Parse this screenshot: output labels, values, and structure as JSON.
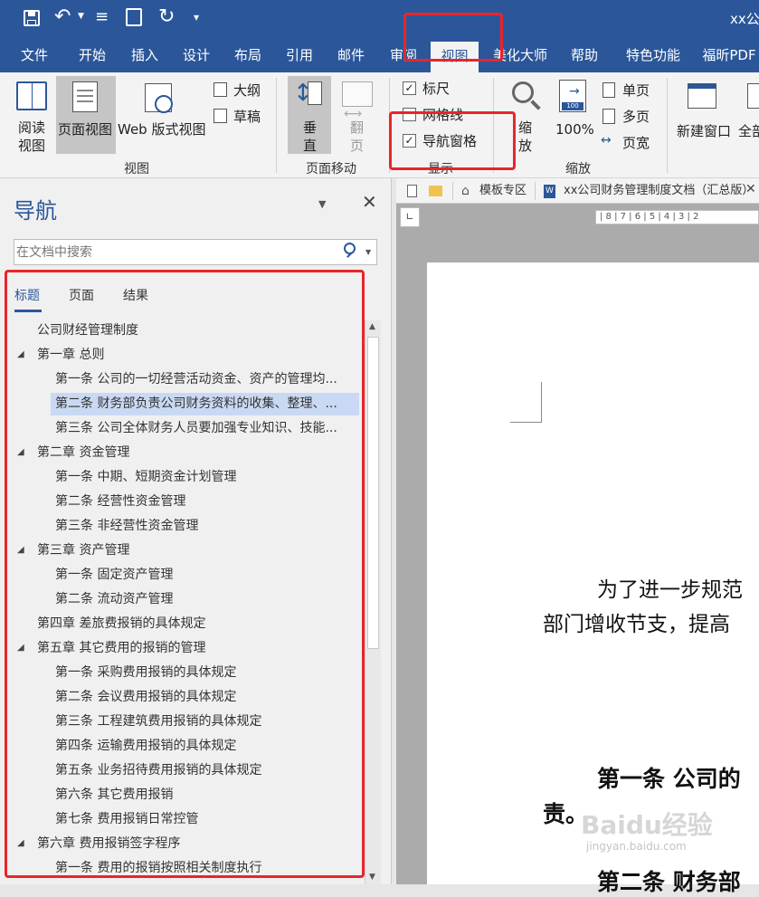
{
  "titlebar": {
    "title": "xx公"
  },
  "tabs": [
    "文件",
    "开始",
    "插入",
    "设计",
    "布局",
    "引用",
    "邮件",
    "审阅",
    "视图",
    "美化大师",
    "帮助",
    "特色功能",
    "福昕PDF"
  ],
  "ribbon": {
    "view_group": {
      "read_label": "阅读\n视图",
      "read_l1": "阅读",
      "read_l2": "视图",
      "print_label": "页面视图",
      "web_label": "Web 版式视图",
      "outline_label": "大纲",
      "draft_label": "草稿",
      "group_label": "视图"
    },
    "page_move": {
      "vertical_l1": "垂",
      "vertical_l2": "直",
      "flip_l1": "翻",
      "flip_l2": "页",
      "group_label": "页面移动"
    },
    "show": {
      "ruler": "标尺",
      "gridlines": "网格线",
      "nav_pane": "导航窗格",
      "group_label": "显示",
      "ruler_checked": true,
      "gridlines_checked": false,
      "nav_checked": true
    },
    "zoom": {
      "zoom_l1": "缩",
      "zoom_l2": "放",
      "percent": "100%",
      "one_page": "单页",
      "multi_page": "多页",
      "page_width": "页宽",
      "group_label": "缩放"
    },
    "window": {
      "new_window": "新建窗口",
      "arrange_all": "全部"
    }
  },
  "nav": {
    "title": "导航",
    "search_placeholder": "在文档中搜索",
    "subtabs": [
      "标题",
      "页面",
      "结果"
    ],
    "items": [
      {
        "text": "公司财经管理制度",
        "level": 0
      },
      {
        "text": "第一章 总则",
        "level": 1
      },
      {
        "text": "第一条 公司的一切经营活动资金、资产的管理均...",
        "level": 2
      },
      {
        "text": "第二条 财务部负责公司财务资料的收集、整理、...",
        "level": 2,
        "selected": true
      },
      {
        "text": "第三条 公司全体财务人员要加强专业知识、技能...",
        "level": 2
      },
      {
        "text": "第二章 资金管理",
        "level": 1
      },
      {
        "text": "第一条 中期、短期资金计划管理",
        "level": 2
      },
      {
        "text": "第二条 经营性资金管理",
        "level": 2
      },
      {
        "text": "第三条 非经营性资金管理",
        "level": 2
      },
      {
        "text": "第三章 资产管理",
        "level": 1
      },
      {
        "text": "第一条 固定资产管理",
        "level": 2
      },
      {
        "text": "第二条 流动资产管理",
        "level": 2
      },
      {
        "text": "第四章 差旅费报销的具体规定",
        "level": 0
      },
      {
        "text": "第五章 其它费用的报销的管理",
        "level": 1
      },
      {
        "text": "第一条 采购费用报销的具体规定",
        "level": 2
      },
      {
        "text": "第二条 会议费用报销的具体规定",
        "level": 2
      },
      {
        "text": "第三条 工程建筑费用报销的具体规定",
        "level": 2
      },
      {
        "text": "第四条 运输费用报销的具体规定",
        "level": 2
      },
      {
        "text": "第五条 业务招待费用报销的具体规定",
        "level": 2
      },
      {
        "text": "第六条 其它费用报销",
        "level": 2
      },
      {
        "text": "第七条 费用报销日常控管",
        "level": 2
      },
      {
        "text": "第六章 费用报销签字程序",
        "level": 1
      },
      {
        "text": "第一条 费用的报销按照相关制度执行",
        "level": 2
      }
    ]
  },
  "doc": {
    "tab_template": "模板专区",
    "tab_doc": "xx公司财务管理制度文档（汇总版）",
    "ruler_text": "| 8 | 7 | 6 | 5 | 4 | 3 | 2",
    "para1_l1": "为了进一步规范",
    "para1_l2": "部门增收节支，提高",
    "art1_l1": "第一条  公司的",
    "art1_l2": "责。",
    "art2": "第二条  财务部",
    "watermark": "Baidu经验",
    "watermark_sub": "jingyan.baidu.com"
  }
}
